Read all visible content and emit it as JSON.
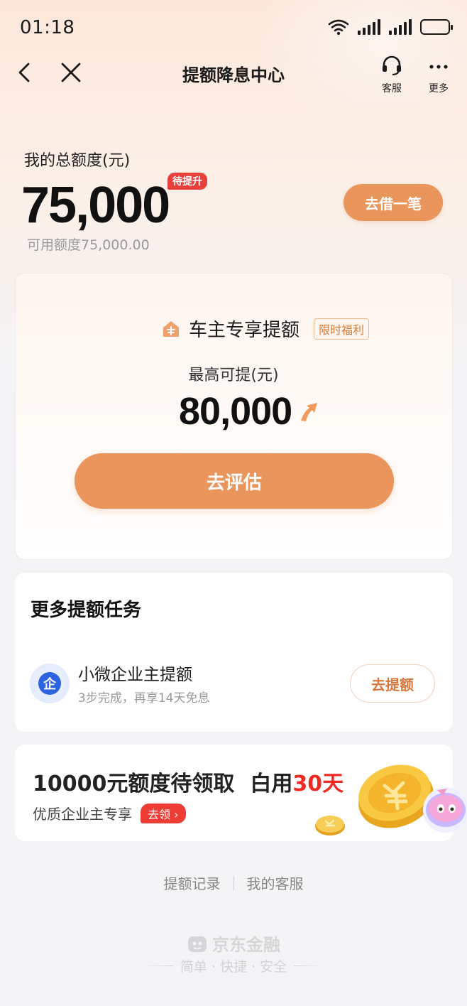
{
  "status_bar": {
    "time": "01:18"
  },
  "nav": {
    "title": "提额降息中心",
    "service_label": "客服",
    "more_label": "更多"
  },
  "quota": {
    "label": "我的总额度(元)",
    "amount": "75,000",
    "badge": "待提升",
    "available": "可用额度75,000.00",
    "borrow_button": "去借一笔"
  },
  "main_card": {
    "title": "车主专享提额",
    "tag": "限时福利",
    "max_label": "最高可提(元)",
    "max_amount": "80,000",
    "evaluate_button": "去评估"
  },
  "tasks": {
    "title": "更多提额任务",
    "items": [
      {
        "icon_text": "企",
        "name": "小微企业主提额",
        "desc": "3步完成，再享14天免息",
        "button": "去提额"
      }
    ]
  },
  "promo": {
    "title_main": "10000元额度待领取",
    "title_tail": "白用",
    "title_highlight": "30天",
    "subtitle": "优质企业主专享",
    "claim": "去领"
  },
  "footer": {
    "links": [
      "提额记录",
      "我的客服"
    ],
    "brand": "京东金融",
    "slogan": "简单 · 快捷 · 安全"
  },
  "colors": {
    "accent": "#ea955b",
    "red": "#ef2a25",
    "blue": "#2b63e0"
  }
}
